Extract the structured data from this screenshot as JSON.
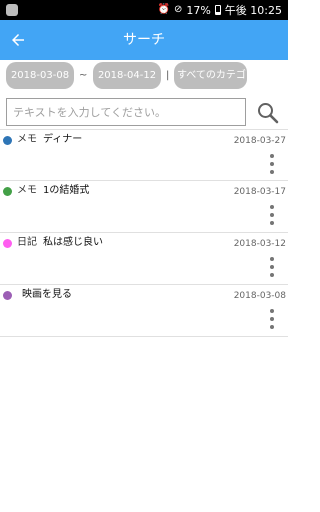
{
  "status_bar": {
    "battery_percent": "17%",
    "time": "午後 10:25"
  },
  "app_bar": {
    "title": "サーチ",
    "back_icon": "arrow-left-icon",
    "color": "#42a5f5"
  },
  "filters": {
    "start_date": "2018-03-08",
    "date_separator": "~",
    "end_date": "2018-04-12",
    "divider": "|",
    "category": "すべてのカテゴリ"
  },
  "search": {
    "placeholder": "テキストを入力してください。",
    "value": "",
    "icon": "search-icon"
  },
  "entries": [
    {
      "color": "#2e75b6",
      "category": "メモ",
      "title": "ディナー",
      "date": "2018-03-27"
    },
    {
      "color": "#43a047",
      "category": "メモ",
      "title": "1の結婚式",
      "date": "2018-03-17"
    },
    {
      "color": "#ff5ef0",
      "category": "日記",
      "title": "私は感じ良い",
      "date": "2018-03-12"
    },
    {
      "color": "#9c5fb5",
      "category": "",
      "title": "映画を見る",
      "date": "2018-03-08"
    }
  ]
}
